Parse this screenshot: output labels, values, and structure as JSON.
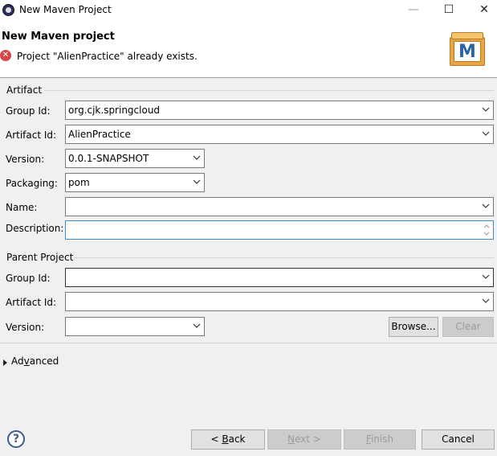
{
  "window": {
    "title": "New Maven Project",
    "controls": {
      "minimize": "—",
      "maximize": "☐",
      "close": "✕"
    }
  },
  "banner": {
    "title": "New Maven project",
    "error_message": "Project \"AlienPractice\" already exists.",
    "error_icon": "✕",
    "logo_letter": "M"
  },
  "artifact": {
    "group_label": "Artifact",
    "group_id": {
      "label": "Group Id:",
      "value": "org.cjk.springcloud"
    },
    "artifact_id": {
      "label": "Artifact Id:",
      "value": "AlienPractice"
    },
    "version": {
      "label": "Version:",
      "value": "0.0.1-SNAPSHOT"
    },
    "packaging": {
      "label": "Packaging:",
      "value": "pom"
    },
    "name": {
      "label": "Name:",
      "value": ""
    },
    "description": {
      "label": "Description:",
      "value": ""
    }
  },
  "parent": {
    "group_label": "Parent Project",
    "group_id": {
      "label": "Group Id:",
      "value": ""
    },
    "artifact_id": {
      "label": "Artifact Id:",
      "value": ""
    },
    "version": {
      "label": "Version:",
      "value": ""
    },
    "browse_label": "Browse...",
    "clear_label": "Clear"
  },
  "advanced": {
    "label_pre": "Ad",
    "label_mnemonic": "v",
    "label_post": "anced"
  },
  "footer": {
    "help_icon": "?",
    "back": {
      "pre": "< ",
      "mnemonic": "B",
      "post": "ack"
    },
    "next": {
      "mnemonic": "N",
      "post": "ext >"
    },
    "finish": {
      "mnemonic": "F",
      "post": "inish"
    },
    "cancel_label": "Cancel"
  },
  "colors": {
    "focus_border": "#3c8ed0",
    "error_red": "#d6454a",
    "maven_blue": "#2a64a8"
  }
}
